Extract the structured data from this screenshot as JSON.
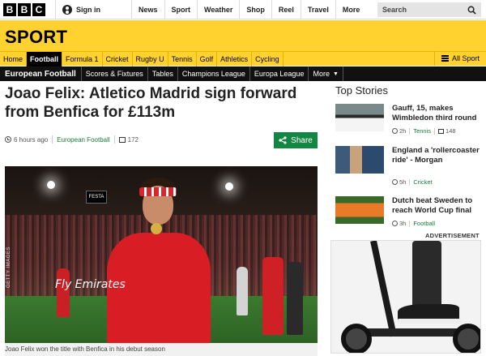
{
  "topbar": {
    "logo_letters": [
      "B",
      "B",
      "C"
    ],
    "signin_label": "Sign in",
    "nav": [
      "News",
      "Sport",
      "Weather",
      "Shop",
      "Reel",
      "Travel"
    ],
    "more_label": "More",
    "search_placeholder": "Search"
  },
  "sport": {
    "title": "SPORT",
    "tabs": [
      "Home",
      "Football",
      "Formula 1",
      "Cricket",
      "Rugby U",
      "Tennis",
      "Golf",
      "Athletics",
      "Cycling"
    ],
    "active_tab": "Football",
    "all_sport_label": "All Sport"
  },
  "subnav": {
    "section": "European Football",
    "tabs": [
      "Scores & Fixtures",
      "Tables",
      "Champions League",
      "Europa League"
    ],
    "more_label": "More"
  },
  "article": {
    "headline": "Joao Felix: Atletico Madrid sign forward from Benfica for £113m",
    "time": "6 hours ago",
    "section_link": "European Football",
    "comments": "172",
    "share_label": "Share",
    "image_credit": "GETTY IMAGES",
    "image_scoreboard": "FESTA",
    "image_shirt_text": "Fly Emirates",
    "caption": "Joao Felix won the title with Benfica in his debut season"
  },
  "top_stories": {
    "title": "Top Stories",
    "items": [
      {
        "title": "Gauff, 15, makes Wimbledon third round",
        "time": "2h",
        "section": "Tennis",
        "comments": "148"
      },
      {
        "title": "England a 'rollercoaster ride' - Morgan",
        "time": "5h",
        "section": "Cricket",
        "comments": ""
      },
      {
        "title": "Dutch beat Sweden to reach World Cup final",
        "time": "3h",
        "section": "Football",
        "comments": ""
      }
    ]
  },
  "advert": {
    "label": "ADVERTISEMENT"
  },
  "colors": {
    "sport_yellow": "#ffd230",
    "share_green": "#128744",
    "link_green": "#1a7a3a"
  }
}
